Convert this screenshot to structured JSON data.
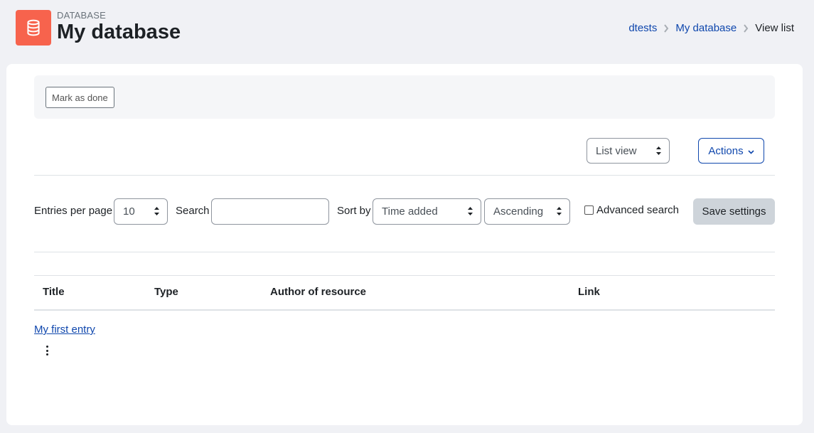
{
  "header": {
    "module_label": "DATABASE",
    "title": "My database",
    "icon": "database-icon",
    "icon_color": "#f7634d"
  },
  "breadcrumb": {
    "items": [
      "dtests",
      "My database"
    ],
    "current": "View list"
  },
  "completion": {
    "mark_done_label": "Mark as done"
  },
  "toolbar": {
    "view_select": "List view",
    "actions_label": "Actions"
  },
  "filters": {
    "entries_per_page_label": "Entries per page",
    "entries_per_page_value": "10",
    "search_label": "Search",
    "search_value": "",
    "sort_by_label": "Sort by",
    "sort_field": "Time added",
    "sort_order": "Ascending",
    "advanced_search_label": "Advanced search",
    "advanced_search_checked": false,
    "save_settings_label": "Save settings"
  },
  "table": {
    "columns": [
      "Title",
      "Type",
      "Author of resource",
      "Link"
    ],
    "rows": [
      {
        "title": "My first entry"
      }
    ]
  },
  "colors": {
    "link": "#0f47ad",
    "accent": "#f7634d"
  }
}
